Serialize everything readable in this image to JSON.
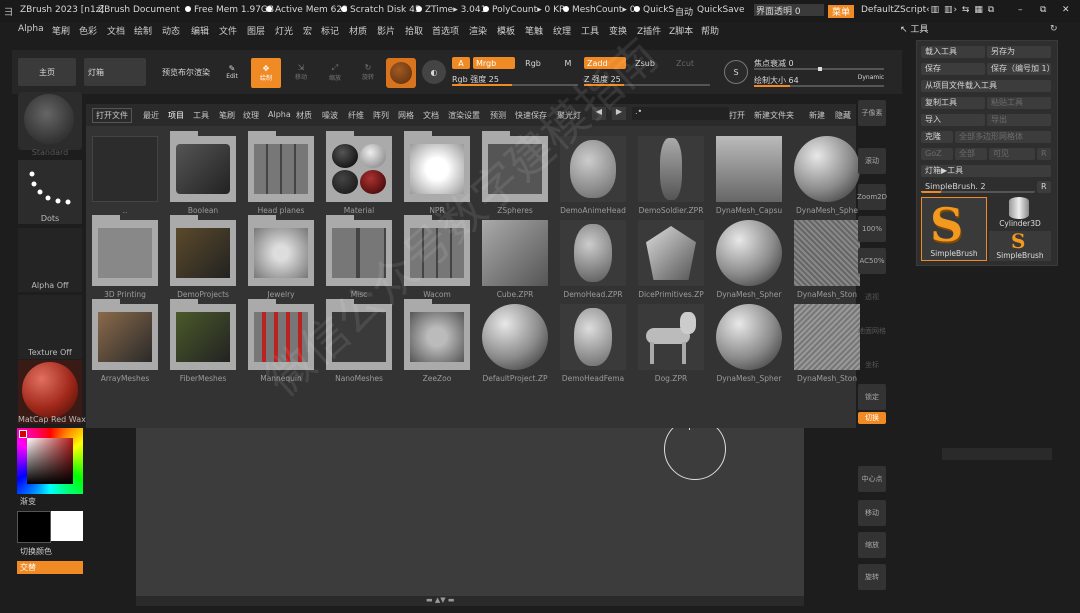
{
  "title_bar": {
    "app_title": "ZBrush 2023 [n1z]",
    "document": "ZBrush Document",
    "free_mem": "Free Mem 1.97GB",
    "active_mem": "Active Mem 623",
    "scratch_disk": "Scratch Disk 45",
    "ztime": "ZTime▸ 3.041",
    "polycount": "PolyCount▸ 0 KP",
    "meshcount": "MeshCount▸ 0",
    "quicks": "QuickS",
    "auto": "自动",
    "quicksave": "QuickSave",
    "transparency": "界面透明 0",
    "menu": "菜单",
    "script": "DefaultZScript"
  },
  "menubar": [
    "Alpha",
    "笔刷",
    "色彩",
    "文档",
    "绘制",
    "动态",
    "编辑",
    "文件",
    "图层",
    "灯光",
    "宏",
    "标记",
    "材质",
    "影片",
    "拾取",
    "首选项",
    "渲染",
    "模板",
    "笔触",
    "纹理",
    "工具",
    "变换",
    "Z插件",
    "Z脚本",
    "帮助"
  ],
  "shelf": {
    "home": "主页",
    "lightbox": "灯箱",
    "preview": "预览布尔渲染",
    "edit": "Edit",
    "draw": "绘制",
    "move": "移动",
    "scale": "缩放",
    "rotate": "旋转",
    "a": "A",
    "mrgb": "Mrgb",
    "rgb": "Rgb",
    "m": "M",
    "rgb_intensity": "Rgb 强度 25",
    "zadd": "Zadd",
    "zsub": "Zsub",
    "zcut": "Zcut",
    "z_intensity": "Z 强度 25",
    "focal": "焦点衰减 0",
    "draw_size": "绘制大小 64",
    "dynamic": "Dynamic"
  },
  "left_tray": {
    "brush": "Standard",
    "stroke": "Dots",
    "alpha": "Alpha Off",
    "texture": "Texture Off",
    "material": "MatCap Red Wax",
    "gradient": "渐变",
    "switch_color": "切换颜色",
    "alternate": "交替"
  },
  "lightbox": {
    "tabs": [
      "打开文件",
      "最近",
      "项目",
      "工具",
      "笔刷",
      "纹理",
      "Alpha",
      "材质",
      "噪波",
      "纤维",
      "阵列",
      "网格",
      "文档",
      "渲染设置",
      "预测",
      "快速保存",
      "聚光灯"
    ],
    "path": ".•",
    "open": "打开",
    "new_folder": "新建文件夹",
    "new": "新建",
    "hide": "隐藏",
    "row1": [
      "..",
      "Boolean",
      "Head planes",
      "Material",
      "NPR",
      "ZSpheres",
      "DemoAnimeHead",
      "DemoSoldier.ZPR",
      "DynaMesh_Capsu",
      "DynaMesh_Sphe"
    ],
    "row2": [
      "3D Printing",
      "DemoProjects",
      "Jewelry",
      "Misc",
      "Wacom",
      "Cube.ZPR",
      "DemoHead.ZPR",
      "DicePrimitives.ZP",
      "DynaMesh_Spher",
      "DynaMesh_Ston"
    ],
    "row3": [
      "ArrayMeshes",
      "FiberMeshes",
      "Mannequin",
      "NanoMeshes",
      "ZeeZoo",
      "DefaultProject.ZP",
      "DemoHeadFema",
      "Dog.ZPR",
      "DynaMesh_Spher",
      "DynaMesh_Ston"
    ]
  },
  "right_toolbar": [
    "子像素",
    "滚动",
    "Zoom2D",
    "100%",
    "AC50%",
    "透视",
    "地面网格",
    "坐标",
    "锁定",
    "切换",
    "中心点",
    "移动",
    "缩放",
    "旋转"
  ],
  "tool_palette": {
    "header": "工具",
    "load_tool": "载入工具",
    "save_as": "另存为",
    "save": "保存",
    "save_numbered": "保存（编号加 1）",
    "load_from_project": "从项目文件载入工具",
    "copy_tool": "复制工具",
    "paste_tool": "粘贴工具",
    "import": "导入",
    "export": "导出",
    "clone": "克隆",
    "all_low": "全部多边形网格体",
    "goz": "GoZ",
    "all": "全部",
    "visible": "可见",
    "r": "R",
    "lightbox_tool": "灯箱▶工具",
    "current_tool": "SimpleBrush. 2",
    "r2": "R",
    "tool1": "SimpleBrush",
    "tool2": "Cylinder3D",
    "tool3": "SimpleBrush"
  },
  "watermark": "微信公众号数字建模指南"
}
